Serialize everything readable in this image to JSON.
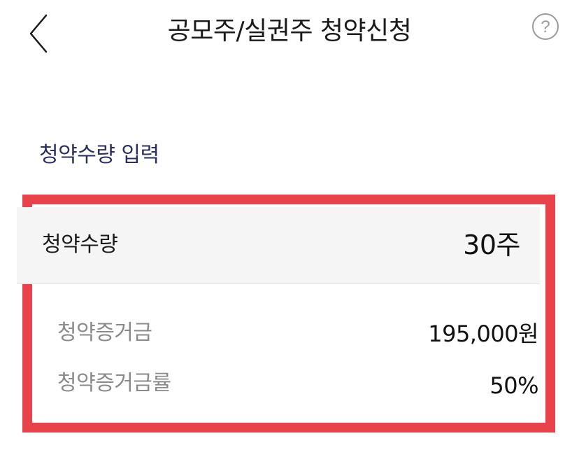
{
  "header": {
    "title": "공모주/실권주 청약신청",
    "back_icon": "chevron-left-icon",
    "help_icon": "question-circle-icon",
    "help_glyph": "?"
  },
  "section": {
    "title": "청약수량 입력"
  },
  "subscription": {
    "quantity_label": "청약수량",
    "quantity_value": "30주",
    "deposit_label": "청약증거금",
    "deposit_value": "195,000원",
    "deposit_rate_label": "청약증거금률",
    "deposit_rate_value": "50%"
  },
  "colors": {
    "highlight_border": "#e8434b",
    "section_title": "#2b2f5e",
    "quantity_row_bg": "#f5f5f5",
    "muted_label": "#8a8a8a"
  }
}
